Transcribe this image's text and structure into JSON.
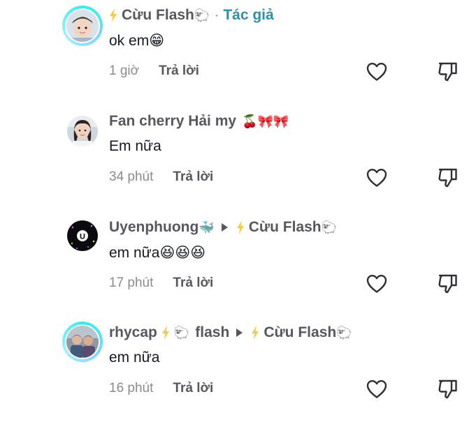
{
  "comments": [
    {
      "author": "Cừu Flash",
      "author_emoji": "🐑",
      "author_tag": "Tác giả",
      "separator": "·",
      "text": "ok em",
      "text_emoji": "😁",
      "time": "1 giờ",
      "reply_label": "Trả lời",
      "avatar": "avatar-child-photo",
      "has_ring": true
    },
    {
      "author": "Fan cherry Hải my",
      "author_emoji": "🍒🎀🎀",
      "text": "Em nữa",
      "time": "34 phút",
      "reply_label": "Trả lời",
      "avatar": "avatar-woman-photo",
      "has_ring": false
    },
    {
      "author": "Uyenphuong",
      "author_emoji": "🐳",
      "reply_to": "Cừu Flash",
      "reply_to_emoji": "🐑",
      "text": "em nữa",
      "text_emoji": "😆😆😆",
      "time": "17 phút",
      "reply_label": "Trả lời",
      "avatar": "avatar-black-u",
      "has_ring": false
    },
    {
      "author": "rhycap",
      "author_emoji_mid": "🐑",
      "author_suffix": "flash",
      "reply_to": "Cừu Flash",
      "reply_to_emoji": "🐑",
      "text": "em nữa",
      "time": "16 phút",
      "reply_label": "Trả lời",
      "avatar": "avatar-group-photo",
      "has_ring": true
    }
  ],
  "icons": {
    "like": "heart-outline-icon",
    "dislike": "thumbs-down-outline-icon",
    "bolt": "lightning-bolt-icon",
    "reply_arrow": "triangle-right-icon"
  },
  "colors": {
    "author_tag": "#2b8fae",
    "bolt": "#f7c948",
    "story_ring": "#25F4EE",
    "name": "#57585f",
    "time": "#8a8b91"
  }
}
